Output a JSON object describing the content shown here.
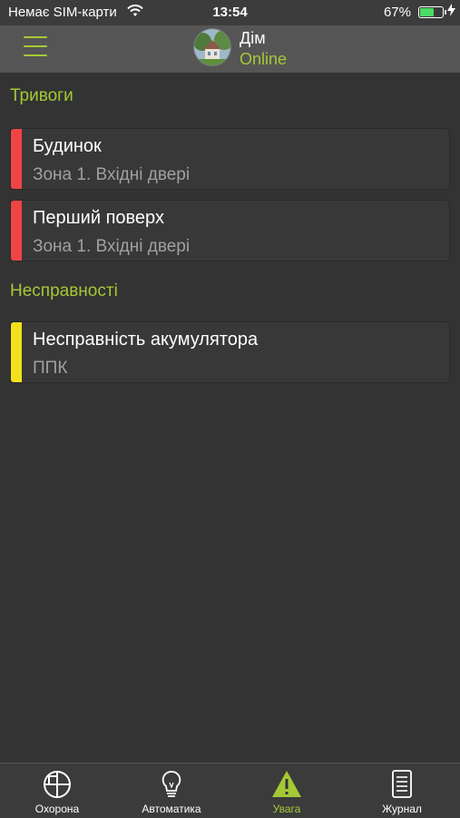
{
  "colors": {
    "accent": "#a5c935",
    "alarm": "#ef4444",
    "fault": "#f2e11c",
    "battery_fill": "#4cd964",
    "background": "#333333"
  },
  "status_bar": {
    "carrier": "Немає SIM-карти",
    "wifi_icon": "wifi-icon",
    "time": "13:54",
    "battery_percent": "67%",
    "battery_level": 0.67
  },
  "nav": {
    "menu_icon": "hamburger-icon",
    "title": "Дім",
    "status": "Online"
  },
  "sections": {
    "alarms": {
      "title": "Тривоги",
      "items": [
        {
          "title": "Будинок",
          "subtitle": "Зона 1. Вхідні двері"
        },
        {
          "title": "Перший поверх",
          "subtitle": "Зона 1. Вхідні двері"
        }
      ]
    },
    "faults": {
      "title": "Несправності",
      "items": [
        {
          "title": "Несправність акумулятора",
          "subtitle": "ППК"
        }
      ]
    }
  },
  "tabs": [
    {
      "label": "Охорона",
      "icon": "shield-grid-icon",
      "active": false
    },
    {
      "label": "Автоматика",
      "icon": "lightbulb-icon",
      "active": false
    },
    {
      "label": "Увага",
      "icon": "warning-icon",
      "active": true
    },
    {
      "label": "Журнал",
      "icon": "journal-icon",
      "active": false
    }
  ]
}
